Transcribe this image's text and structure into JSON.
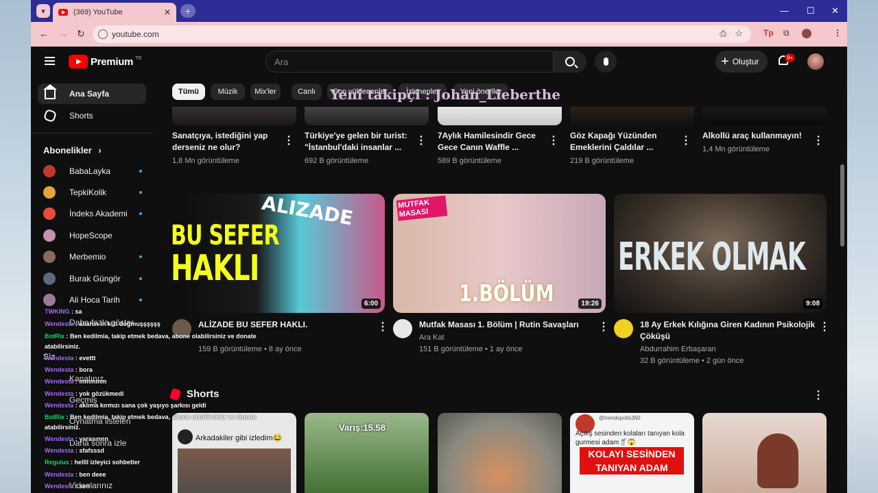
{
  "browser": {
    "tab_title": "(369) YouTube",
    "url": "youtube.com"
  },
  "header": {
    "logo_text": "Premium",
    "logo_region": "TR",
    "search_placeholder": "Ara",
    "create_label": "Oluştur",
    "notification_count": "9+"
  },
  "sidebar": {
    "nav": [
      {
        "label": "Ana Sayfa",
        "icon": "home-icon",
        "active": true
      },
      {
        "label": "Shorts",
        "icon": "shorts-icon",
        "active": false
      }
    ],
    "subscriptions_title": "Abonelikler",
    "subscriptions": [
      {
        "name": "BabaLayka",
        "color": "#c0392b"
      },
      {
        "name": "TepkiKolik",
        "color": "#e8a33d"
      },
      {
        "name": "İndeks Akademi",
        "color": "#e74c3c"
      },
      {
        "name": "HopeScope",
        "color": "#c88fb0"
      },
      {
        "name": "Merbemio",
        "color": "#8a6a5a"
      },
      {
        "name": "Burak Güngör",
        "color": "#5a6a7a"
      },
      {
        "name": "Ali Hoca Tarih",
        "color": "#9a7a9a"
      }
    ],
    "partial_items": [
      "Daha fazla göster",
      "Siz",
      "Kanalınız",
      "Geçmiş",
      "Oynatma listeleri",
      "Daha sonra izle",
      "Videolarınız"
    ]
  },
  "chips": [
    {
      "label": "Tümü",
      "active": true
    },
    {
      "label": "Müzik",
      "active": false
    },
    {
      "label": "Mix'ler",
      "active": false
    },
    {
      "label": "Canlı",
      "active": false
    },
    {
      "label": "Son yüklenenler",
      "active": false
    },
    {
      "label": "İzlenenler",
      "active": false
    },
    {
      "label": "Yeni öneriler",
      "active": false
    }
  ],
  "overlay_follow": "Yeni takipçi : Johan_Lieberthe",
  "row1": [
    {
      "title1": "Sanatçıya, istediğini yap",
      "title2": "derseniz ne olur?",
      "meta": "1,8 Mn görüntüleme"
    },
    {
      "title1": "Türkiye'ye gelen bir turist:",
      "title2": "\"İstanbul'daki insanlar ...",
      "meta": "692 B görüntüleme"
    },
    {
      "title1": "7Aylık Hamilesindir Gece",
      "title2": "Gece Canın Waffle ...",
      "meta": "589 B görüntüleme"
    },
    {
      "title1": "Göz Kapağı Yüzünden",
      "title2": "Emeklerini Çaldılar ...",
      "meta": "219 B görüntüleme"
    },
    {
      "title1": "Alkollü araç kullanmayın!",
      "title2": "",
      "meta": "1,4 Mn görüntüleme"
    }
  ],
  "row2": [
    {
      "title1": "ALİZADE BU SEFER HAKLI.",
      "title2": "",
      "channel": "",
      "meta": "159 B görüntüleme • 8 ay önce",
      "duration": "6:00",
      "thumb_text1": "BU SEFER",
      "thumb_text2": "HAKLI",
      "thumb_tag": "ALIZADE"
    },
    {
      "title1": "Mutfak Masası 1. Bölüm | Rutin Savaşları",
      "title2": "",
      "channel": "Ara Kat",
      "meta": "151 B görüntüleme • 1 ay önce",
      "duration": "19:26",
      "thumb_text1": "MUTFAK MASASI",
      "thumb_text2": "1.BÖLÜM",
      "thumb_tag": ""
    },
    {
      "title1": "18 Ay Erkek Kılığına Giren Kadının Psikolojik",
      "title2": "Çöküşü",
      "channel": "Abdurrahim Erbaşaran",
      "meta": "32 B görüntüleme • 2 gün önce",
      "duration": "9:08",
      "thumb_text1": "ERKEK OLMAK",
      "thumb_text2": "",
      "thumb_tag": ""
    }
  ],
  "shorts": {
    "title": "Shorts",
    "items": [
      {
        "caption": "Arkadakiler gibi izledim😂",
        "top": ""
      },
      {
        "caption": "Varış:15.58",
        "top": ""
      },
      {
        "caption": "",
        "top": ""
      },
      {
        "caption": "Açılış sesinden kolaları tanıyan kola gurmesi adam🥤😱",
        "top": "@trendopolls360",
        "banner": "KOLAYI SESİNDEN TANIYAN ADAM"
      },
      {
        "caption": "",
        "top": ""
      }
    ]
  },
  "chat": [
    {
      "name": "TWKING",
      "text": ": sa",
      "color": "#a970ff"
    },
    {
      "name": "Wendesta",
      "text": ": allahin in kizi doğmuşşşşşş",
      "color": "#a970ff"
    },
    {
      "name": "BotRix",
      "text": ": Ben kedilmia, takip etmek bedava, abone olabilirsiniz ve donate",
      "color": "#00e676"
    },
    {
      "name": "",
      "text": "atabilirsiniz.",
      "color": "#a970ff"
    },
    {
      "name": "Wendesta",
      "text": ": evettt",
      "color": "#a970ff"
    },
    {
      "name": "Wendesta",
      "text": ": bora",
      "color": "#a970ff"
    },
    {
      "name": "Wendesta",
      "text": ": mmmmm",
      "color": "#a970ff"
    },
    {
      "name": "Wendesta",
      "text": ": yok gözükmedi",
      "color": "#a970ff"
    },
    {
      "name": "Wendesta",
      "text": ": aklıma kırmızı sana çok yaşıyo şarkısı geldi",
      "color": "#a970ff"
    },
    {
      "name": "BotRix",
      "text": ": Ben kedilmia, takip etmek bedava, abone olabilirsiniz ve donate",
      "color": "#00e676"
    },
    {
      "name": "",
      "text": "atabilirsiniz.",
      "color": "#a970ff"
    },
    {
      "name": "Wendesta",
      "text": ": yarasınnn",
      "color": "#a970ff"
    },
    {
      "name": "Wendesta",
      "text": ": sfafsssd",
      "color": "#a970ff"
    },
    {
      "name": "Regulus",
      "text": ": hellll izleyici sohbetler",
      "color": "#00e676"
    },
    {
      "name": "Wendesta",
      "text": ": ben deee",
      "color": "#a970ff"
    },
    {
      "name": "Wendesta",
      "text": ": sen",
      "color": "#a970ff"
    }
  ]
}
